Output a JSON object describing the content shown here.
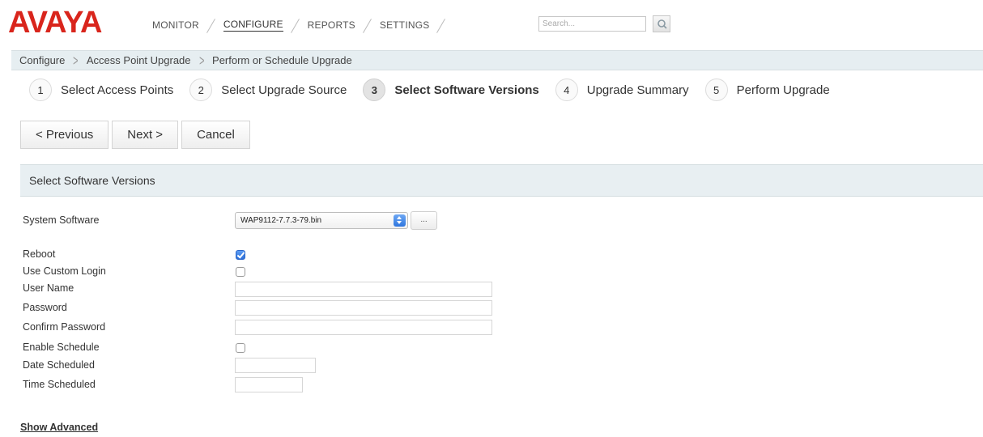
{
  "brand": {
    "logo_text": "AVAYA",
    "logo_color": "#d9251c"
  },
  "nav": {
    "items": [
      {
        "label": "MONITOR",
        "active": false
      },
      {
        "label": "CONFIGURE",
        "active": true
      },
      {
        "label": "REPORTS",
        "active": false
      },
      {
        "label": "SETTINGS",
        "active": false
      }
    ],
    "search_placeholder": "Search...",
    "search_icon": "search-icon"
  },
  "breadcrumb": [
    "Configure",
    "Access Point Upgrade",
    "Perform or Schedule Upgrade"
  ],
  "steps": [
    {
      "number": "1",
      "label": "Select Access Points",
      "current": false
    },
    {
      "number": "2",
      "label": "Select Upgrade Source",
      "current": false
    },
    {
      "number": "3",
      "label": "Select Software Versions",
      "current": true
    },
    {
      "number": "4",
      "label": "Upgrade Summary",
      "current": false
    },
    {
      "number": "5",
      "label": "Perform Upgrade",
      "current": false
    }
  ],
  "buttons": {
    "previous": "< Previous",
    "next": "Next >",
    "cancel": "Cancel"
  },
  "section": {
    "title": "Select Software Versions"
  },
  "form": {
    "system_software": {
      "label": "System Software",
      "value": "WAP9112-7.7.3-79.bin",
      "browse_label": "..."
    },
    "reboot": {
      "label": "Reboot",
      "checked": true
    },
    "use_custom_login": {
      "label": "Use Custom Login",
      "checked": false
    },
    "user_name": {
      "label": "User Name",
      "value": ""
    },
    "password": {
      "label": "Password",
      "value": ""
    },
    "confirm_password": {
      "label": "Confirm Password",
      "value": ""
    },
    "enable_schedule": {
      "label": "Enable Schedule",
      "checked": false
    },
    "date_scheduled": {
      "label": "Date Scheduled",
      "value": ""
    },
    "time_scheduled": {
      "label": "Time Scheduled",
      "value": ""
    }
  },
  "advanced_link": "Show Advanced",
  "colors": {
    "accent_blue": "#2f76de",
    "header_bg": "#e8eff2"
  }
}
